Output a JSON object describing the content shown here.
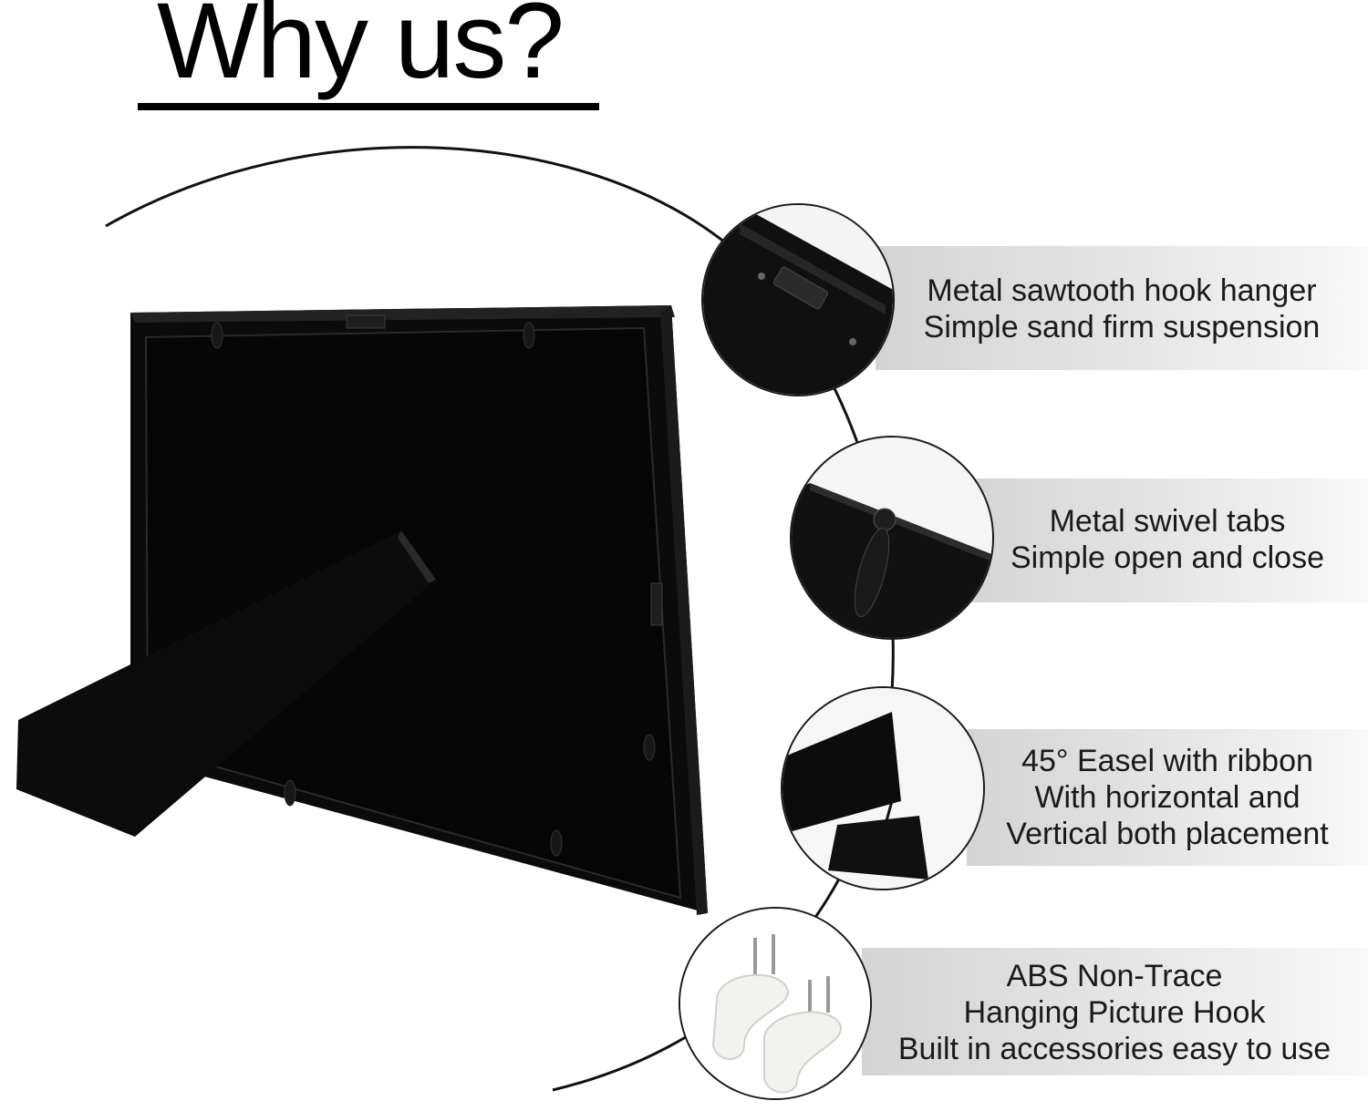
{
  "title": "Why us?",
  "features": [
    {
      "icon": "sawtooth-hanger",
      "lines": [
        "Metal sawtooth hook hanger",
        "Simple sand firm suspension"
      ]
    },
    {
      "icon": "swivel-tab",
      "lines": [
        "Metal swivel tabs",
        "Simple open and close"
      ]
    },
    {
      "icon": "easel-stand",
      "lines": [
        "45°  Easel with ribbon",
        "With horizontal and",
        "Vertical both placement"
      ]
    },
    {
      "icon": "wall-hooks",
      "lines": [
        "ABS Non-Trace",
        "Hanging Picture Hook",
        "Built in accessories easy to use"
      ]
    }
  ],
  "colors": {
    "frame": "#0b0b0b",
    "band": "#e2e2e2",
    "text": "#1a1a1a"
  }
}
